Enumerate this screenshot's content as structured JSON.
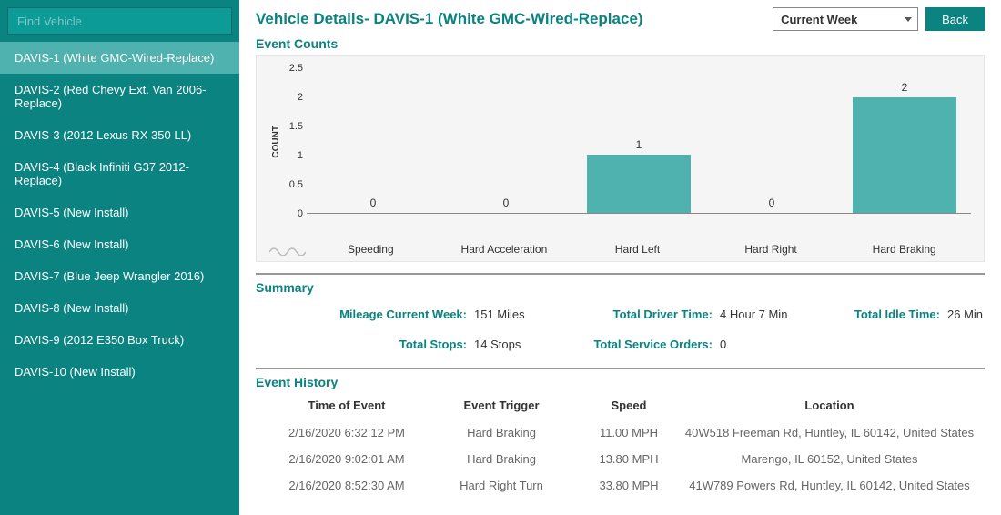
{
  "sidebar": {
    "search_placeholder": "Find Vehicle",
    "items": [
      {
        "label": "DAVIS-1 (White GMC-Wired-Replace)",
        "active": true
      },
      {
        "label": "DAVIS-2 (Red Chevy Ext. Van 2006-Replace)",
        "active": false
      },
      {
        "label": "DAVIS-3 (2012 Lexus RX 350 LL)",
        "active": false
      },
      {
        "label": "DAVIS-4 (Black Infiniti G37 2012-Replace)",
        "active": false
      },
      {
        "label": "DAVIS-5 (New Install)",
        "active": false
      },
      {
        "label": "DAVIS-6 (New Install)",
        "active": false
      },
      {
        "label": "DAVIS-7 (Blue Jeep Wrangler 2016)",
        "active": false
      },
      {
        "label": "DAVIS-8 (New Install)",
        "active": false
      },
      {
        "label": "DAVIS-9 (2012 E350 Box Truck)",
        "active": false
      },
      {
        "label": "DAVIS-10 (New Install)",
        "active": false
      }
    ]
  },
  "header": {
    "title": "Vehicle Details- DAVIS-1 (White GMC-Wired-Replace)",
    "period_selected": "Current Week",
    "back_label": "Back"
  },
  "sections": {
    "event_counts": "Event Counts",
    "summary": "Summary",
    "event_history": "Event History"
  },
  "chart_data": {
    "type": "bar",
    "ylabel": "COUNT",
    "ylim": [
      0,
      2.5
    ],
    "yticks": [
      0,
      0.5,
      1,
      1.5,
      2,
      2.5
    ],
    "categories": [
      "Speeding",
      "Hard Acceleration",
      "Hard Left",
      "Hard Right",
      "Hard Braking"
    ],
    "values": [
      0,
      0,
      1,
      0,
      2
    ],
    "bar_color": "#4fb2af"
  },
  "summary": {
    "labels": {
      "mileage": "Mileage Current Week:",
      "driver_time": "Total Driver Time:",
      "idle_time": "Total Idle Time:",
      "stops": "Total Stops:",
      "service_orders": "Total Service Orders:"
    },
    "values": {
      "mileage": "151 Miles",
      "driver_time": "4 Hour 7 Min",
      "idle_time": "26 Min",
      "stops": "14 Stops",
      "service_orders": "0"
    }
  },
  "history": {
    "headers": {
      "time": "Time of Event",
      "trigger": "Event Trigger",
      "speed": "Speed",
      "location": "Location"
    },
    "rows": [
      {
        "time": "2/16/2020 6:32:12 PM",
        "trigger": "Hard Braking",
        "speed": "11.00 MPH",
        "location": "40W518 Freeman Rd, Huntley, IL 60142, United States"
      },
      {
        "time": "2/16/2020 9:02:01 AM",
        "trigger": "Hard Braking",
        "speed": "13.80 MPH",
        "location": "Marengo, IL 60152, United States"
      },
      {
        "time": "2/16/2020 8:52:30 AM",
        "trigger": "Hard Right Turn",
        "speed": "33.80 MPH",
        "location": "41W789 Powers Rd, Huntley, IL 60142, United States"
      }
    ]
  }
}
